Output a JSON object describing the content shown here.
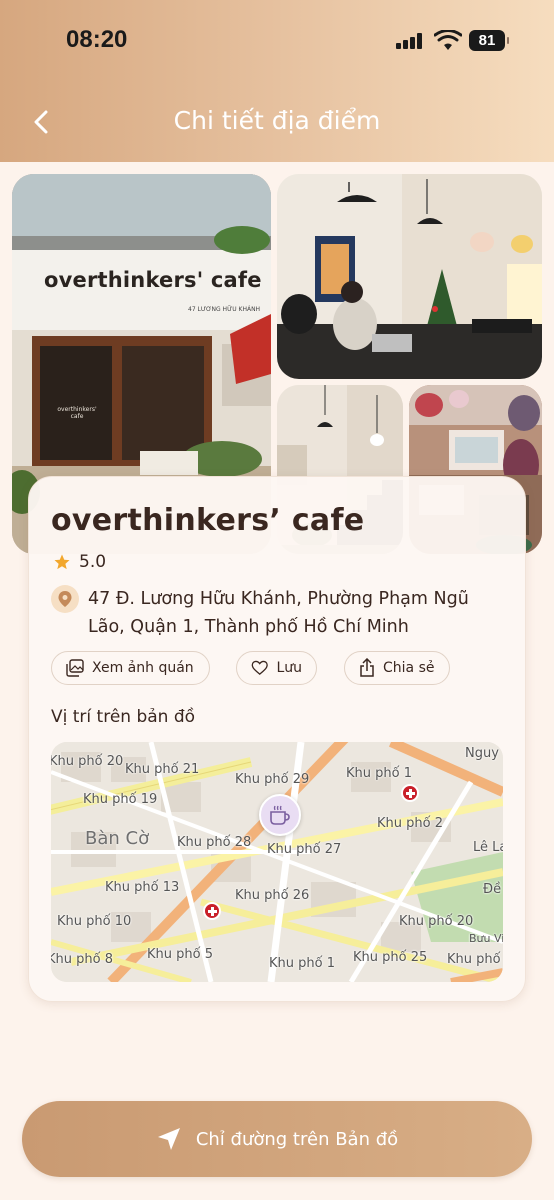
{
  "status_bar": {
    "time": "08:20",
    "battery": "81"
  },
  "header": {
    "title": "Chi tiết địa điểm",
    "back_icon": "chevron-left-icon"
  },
  "photos": {
    "main_sign": "overthinkers' cafe",
    "main_sign_address": "47 LƯƠNG HỮU KHÁNH",
    "door_sign": "overthinkers' cafe"
  },
  "place": {
    "name": "overthinkers’ cafe",
    "rating": "5.0",
    "address": "47 Đ. Lương Hữu Khánh, Phường Phạm Ngũ Lão, Quận 1, Thành phố Hồ Chí Minh"
  },
  "actions": {
    "view_photos": "Xem ảnh quán",
    "save": "Lưu",
    "share": "Chia sẻ"
  },
  "map": {
    "heading": "Vị trí trên bản đồ",
    "district": "Bàn Cờ",
    "labels": [
      "Khu phố 20",
      "Khu phố 21",
      "Khu phố 29",
      "Khu phố 1",
      "Nguy",
      "Khu phố 19",
      "Khu phố 28",
      "Khu phố 27",
      "Khu phố 2",
      "Lê La",
      "Khu phố 13",
      "Khu phố 26",
      "Khu phố 10",
      "Khu phố 20",
      "Đề Th",
      "Khu phố 5",
      "Khu phố 1",
      "Khu phố 25",
      "Khu phố 8",
      "Khu phố",
      "Bưu Viện"
    ]
  },
  "footer": {
    "directions": "Chỉ đường trên Bản đồ"
  },
  "colors": {
    "accent": "#d6a77f",
    "star": "#f2a72d",
    "background": "#fdf3ec",
    "text": "#3a2720"
  }
}
